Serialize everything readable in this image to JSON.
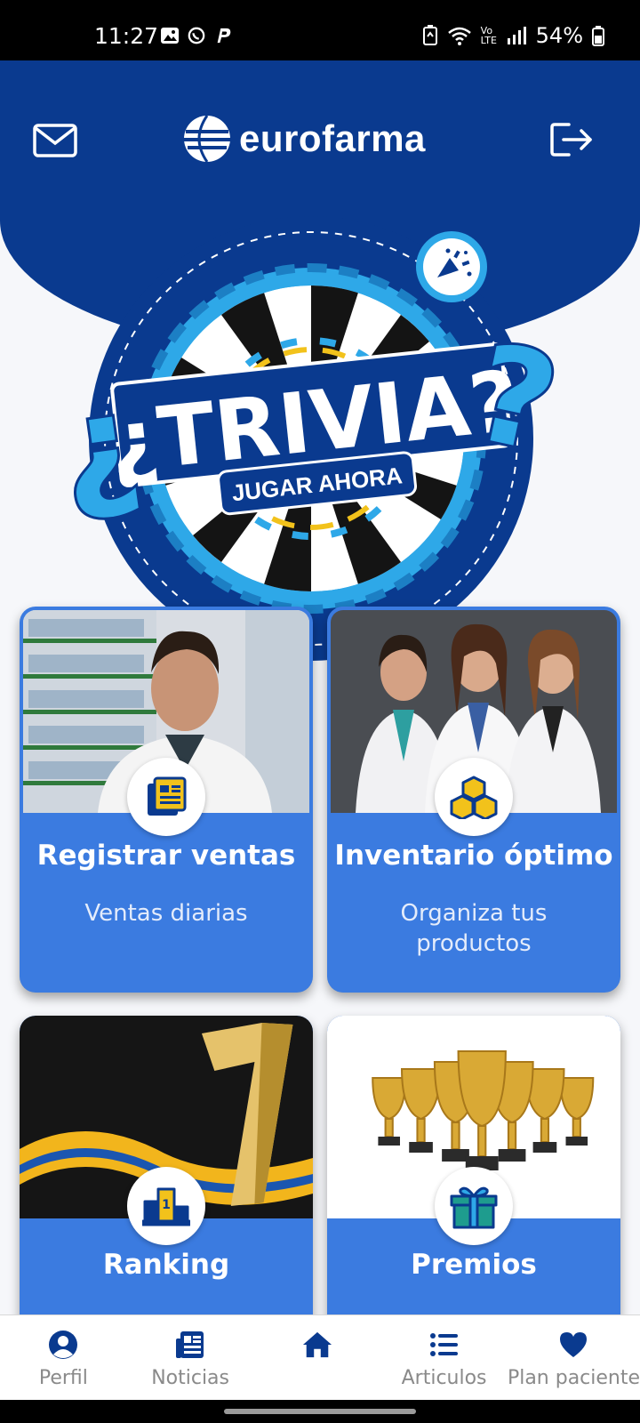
{
  "status_bar": {
    "time": "11:27",
    "battery": "54%",
    "network_label": "LTE"
  },
  "header": {
    "logo_text": "eurofarma",
    "mail_icon": "envelope-icon",
    "logout_icon": "logout-icon"
  },
  "trivia": {
    "title": "¿TRIVIA?",
    "cta": "JUGAR AHORA",
    "badge_icon": "party-popper-icon"
  },
  "cards": [
    {
      "title": "Registrar ventas",
      "subtitle": "Ventas diarias",
      "icon": "document-list-icon"
    },
    {
      "title": "Inventario óptimo",
      "subtitle": "Organiza tus productos",
      "icon": "boxes-icon"
    },
    {
      "title": "Ranking",
      "subtitle": "",
      "icon": "podium-icon"
    },
    {
      "title": "Premios",
      "subtitle": "",
      "icon": "gift-icon"
    }
  ],
  "bottom_nav": {
    "items": [
      {
        "label": "Perfil",
        "icon": "user-circle-icon"
      },
      {
        "label": "Noticias",
        "icon": "newspaper-icon"
      },
      {
        "label": "",
        "icon": "home-icon"
      },
      {
        "label": "Articulos",
        "icon": "list-icon"
      },
      {
        "label": "Plan paciente",
        "icon": "heart-icon"
      }
    ]
  },
  "colors": {
    "header_blue": "#0a3a8f",
    "card_blue": "#3b7be0",
    "nav_active": "#0a3a8f",
    "trivia_light_blue": "#2ea8e8"
  }
}
